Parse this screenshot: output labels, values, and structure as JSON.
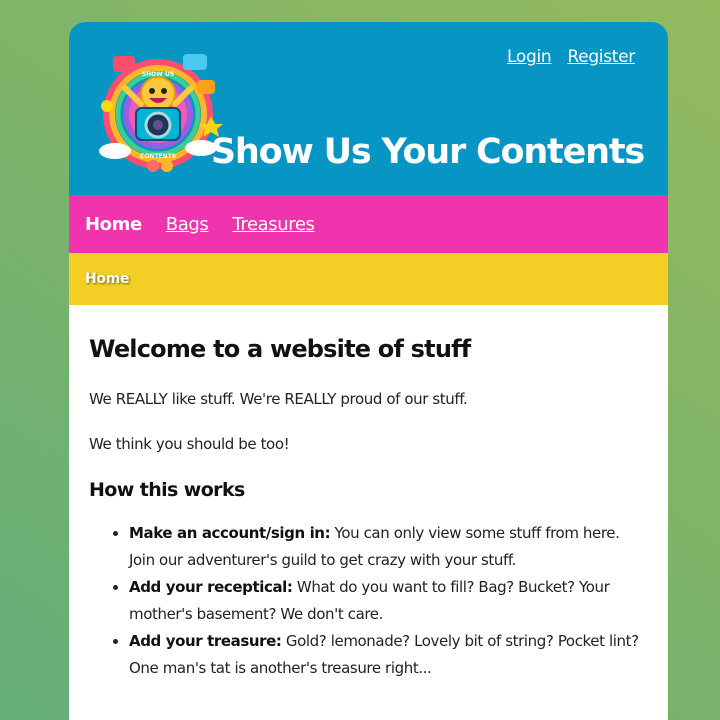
{
  "header": {
    "title": "Show Us Your Contents",
    "login_label": "Login",
    "register_label": "Register",
    "logo_icon": "camera-mascot-logo-icon",
    "logo_text_top": "SHOW US",
    "logo_text_bottom": "CONTENTS"
  },
  "nav": {
    "items": [
      {
        "label": "Home",
        "active": true
      },
      {
        "label": "Bags",
        "active": false
      },
      {
        "label": "Treasures",
        "active": false
      }
    ]
  },
  "breadcrumb": {
    "current": "Home"
  },
  "main": {
    "heading": "Welcome to a website of stuff",
    "paragraphs": [
      "We REALLY like stuff. We're REALLY proud of our stuff.",
      "We think you should be too!"
    ],
    "subheading": "How this works",
    "steps": [
      {
        "title": "Make an account/sign in:",
        "text": " You can only view some stuff from here. Join our adventurer's guild to get crazy with your stuff."
      },
      {
        "title": "Add your receptical:",
        "text": " What do you want to fill? Bag? Bucket? Your mother's basement? We don't care."
      },
      {
        "title": "Add your treasure:",
        "text": " Gold? lemonade? Lovely bit of string? Pocket lint? One man's tat is another's treasure right..."
      }
    ]
  },
  "colors": {
    "header": "#0795c3",
    "nav": "#f034ad",
    "breadcrumb": "#f3cf25",
    "card": "#ffffff"
  }
}
